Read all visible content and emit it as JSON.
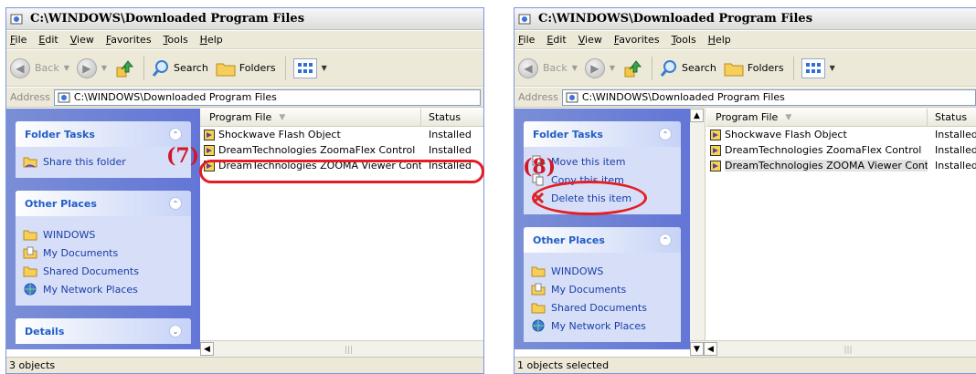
{
  "left": {
    "title": "C:\\WINDOWS\\Downloaded Program Files",
    "menu": [
      "File",
      "Edit",
      "View",
      "Favorites",
      "Tools",
      "Help"
    ],
    "toolbar": {
      "back": "Back",
      "search": "Search",
      "folders": "Folders"
    },
    "address": {
      "label": "Address",
      "value": "C:\\WINDOWS\\Downloaded Program Files"
    },
    "groups": {
      "folder_tasks": {
        "title": "Folder Tasks",
        "items": [
          "Share this folder"
        ]
      },
      "other_places": {
        "title": "Other Places",
        "items": [
          "WINDOWS",
          "My Documents",
          "Shared Documents",
          "My Network Places"
        ]
      },
      "details": {
        "title": "Details"
      }
    },
    "columns": [
      "Program File",
      "Status"
    ],
    "rows": [
      {
        "name": "Shockwave Flash Object",
        "status": "Installed"
      },
      {
        "name": "DreamTechnologies ZoomaFlex Control",
        "status": "Installed"
      },
      {
        "name": "DreamTechnologies ZOOMA Viewer Control",
        "status": "Installed"
      }
    ],
    "status": "3 objects",
    "annotation": "(7)"
  },
  "right": {
    "title": "C:\\WINDOWS\\Downloaded Program Files",
    "menu": [
      "File",
      "Edit",
      "View",
      "Favorites",
      "Tools",
      "Help"
    ],
    "toolbar": {
      "back": "Back",
      "search": "Search",
      "folders": "Folders"
    },
    "address": {
      "label": "Address",
      "value": "C:\\WINDOWS\\Downloaded Program Files"
    },
    "groups": {
      "folder_tasks": {
        "title": "Folder Tasks",
        "items": [
          "Move this item",
          "Copy this item",
          "Delete this item"
        ]
      },
      "other_places": {
        "title": "Other Places",
        "items": [
          "WINDOWS",
          "My Documents",
          "Shared Documents",
          "My Network Places"
        ]
      }
    },
    "columns": [
      "Program File",
      "Status"
    ],
    "rows": [
      {
        "name": "Shockwave Flash Object",
        "status": "Installed"
      },
      {
        "name": "DreamTechnologies ZoomaFlex Control",
        "status": "Installed"
      },
      {
        "name": "DreamTechnologies ZOOMA Viewer Control",
        "status": "Installed"
      }
    ],
    "status": "1 objects selected",
    "annotation": "(8)"
  }
}
